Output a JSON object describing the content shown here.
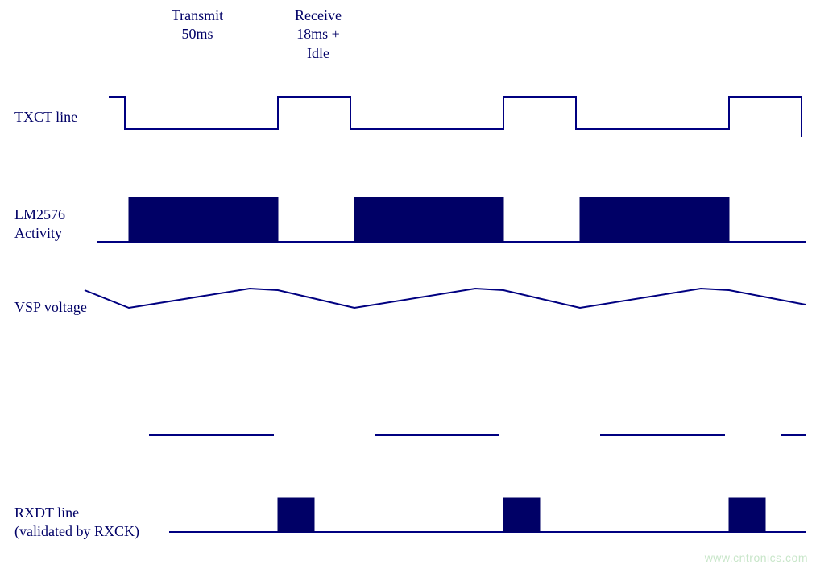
{
  "headers": {
    "transmit": {
      "line1": "Transmit",
      "line2": "50ms"
    },
    "receive": {
      "line1": "Receive",
      "line2": "18ms +",
      "line3": "Idle"
    }
  },
  "signals": {
    "txct": {
      "label": "TXCT line"
    },
    "lm": {
      "label1": "LM2576",
      "label2": "Activity"
    },
    "vsp": {
      "label": "VSP voltage"
    },
    "rxdt": {
      "label1": "RXDT line",
      "label2": "(validated by RXCK)"
    }
  },
  "watermark": "www.cntronics.com",
  "chart_data": {
    "type": "timing-diagram",
    "time_unit": "ms",
    "period": 78,
    "phases": [
      {
        "name": "Transmit",
        "duration_ms": 50
      },
      {
        "name": "Receive+Idle",
        "duration_ms": 28,
        "note": "18ms + Idle"
      }
    ],
    "cycles_shown": 3.5,
    "signals": [
      {
        "name": "TXCT line",
        "type": "digital",
        "description": "Low during Transmit (50ms), high during Receive/Idle (≈28ms), repeating",
        "levels_per_cycle": [
          {
            "phase": "Transmit",
            "level": "low"
          },
          {
            "phase": "Receive+Idle",
            "level": "high"
          }
        ]
      },
      {
        "name": "LM2576 Activity",
        "type": "activity-block",
        "description": "Switching regulator active (solid burst) only during Transmit phase",
        "active_during": "Transmit"
      },
      {
        "name": "VSP voltage",
        "type": "analog",
        "description": "Sawtooth-like ripple: rises during Transmit (LM2576 active), decays during Receive/Idle"
      },
      {
        "name": "dashed line",
        "type": "digital",
        "description": "High pulses aligned with Transmit windows (dashed / faint segments)"
      },
      {
        "name": "RXDT line (validated by RXCK)",
        "type": "digital-burst",
        "description": "Short filled data burst near the end of each Receive window"
      }
    ]
  }
}
